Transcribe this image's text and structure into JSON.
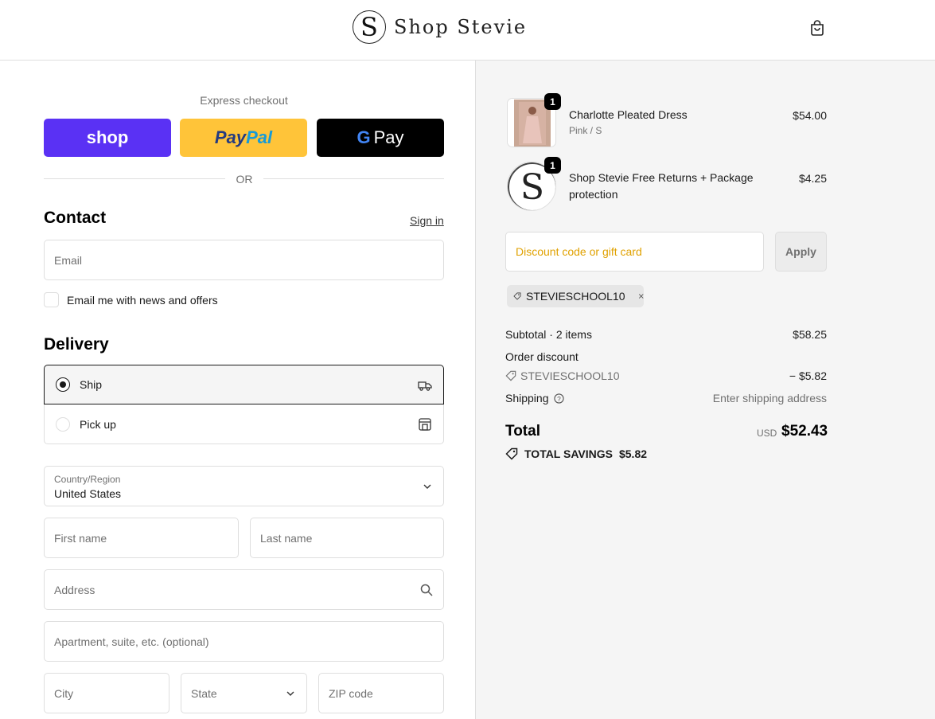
{
  "header": {
    "logo_letter": "S",
    "store_name": "Shop Stevie",
    "cart_icon": "shopping-bag-icon"
  },
  "checkout": {
    "express_title": "Express checkout",
    "shop_pay_label": "shop",
    "paypal_label_a": "Pay",
    "paypal_label_b": "Pal",
    "gpay_g": "G",
    "gpay_label": "Pay",
    "or_label": "OR",
    "contact": {
      "title": "Contact",
      "sign_in": "Sign in",
      "email_placeholder": "Email",
      "newsletter_label": "Email me with news and offers"
    },
    "delivery": {
      "title": "Delivery",
      "options": [
        {
          "label": "Ship",
          "selected": true,
          "icon": "truck-icon"
        },
        {
          "label": "Pick up",
          "selected": false,
          "icon": "store-icon"
        }
      ],
      "country_label": "Country/Region",
      "country_value": "United States",
      "first_name": "First name",
      "last_name": "Last name",
      "address": "Address",
      "apartment": "Apartment, suite, etc. (optional)",
      "city": "City",
      "state": "State",
      "zip": "ZIP code"
    }
  },
  "summary": {
    "items": [
      {
        "qty": "1",
        "name": "Charlotte Pleated Dress",
        "variant": "Pink / S",
        "price": "$54.00"
      },
      {
        "qty": "1",
        "name_line1": "Shop Stevie Free Returns + Package",
        "name_line2": "protection",
        "price": "$4.25"
      }
    ],
    "discount_placeholder": "Discount code or gift card",
    "apply_label": "Apply",
    "applied_code": "STEVIESCHOOL10",
    "subtotal_label": "Subtotal · 2 items",
    "subtotal_value": "$58.25",
    "order_discount_label": "Order discount",
    "discount_code": "STEVIESCHOOL10",
    "discount_value": "− $5.82",
    "shipping_label": "Shipping",
    "shipping_value": "Enter shipping address",
    "total_label": "Total",
    "currency": "USD",
    "total_value": "$52.43",
    "savings_label": "TOTAL SAVINGS",
    "savings_value": "$5.82"
  },
  "colors": {
    "shop_pay": "#5a31f4",
    "paypal": "#ffc439",
    "gpay": "#000000",
    "summary_bg": "#f5f5f5"
  }
}
